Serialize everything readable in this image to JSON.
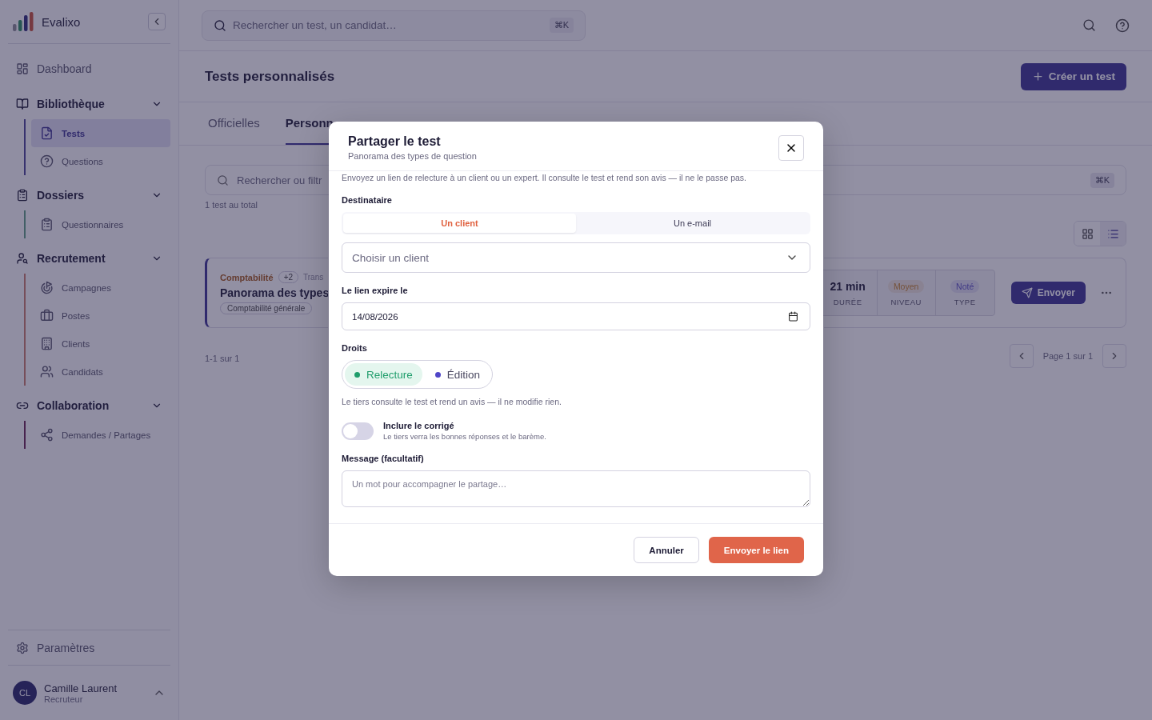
{
  "app": {
    "name": "Evalixo"
  },
  "sidebar": {
    "items": [
      {
        "kind": "link",
        "label": "Dashboard",
        "selected": false
      },
      {
        "kind": "section",
        "label": "Bibliothèque",
        "expanded": true,
        "children": [
          {
            "label": "Tests",
            "selected": true
          },
          {
            "label": "Questions",
            "selected": false
          }
        ]
      },
      {
        "kind": "section",
        "label": "Dossiers",
        "expanded": true,
        "children": [
          {
            "label": "Questionnaires",
            "selected": false
          }
        ]
      },
      {
        "kind": "section",
        "label": "Recrutement",
        "expanded": true,
        "children": [
          {
            "label": "Campagnes",
            "selected": false
          },
          {
            "label": "Postes",
            "selected": false
          },
          {
            "label": "Clients",
            "selected": false
          },
          {
            "label": "Candidats",
            "selected": false
          }
        ]
      },
      {
        "kind": "section",
        "label": "Collaboration",
        "expanded": true,
        "children": [
          {
            "label": "Demandes / Partages",
            "selected": false
          }
        ]
      }
    ],
    "settings": "Paramètres",
    "user": {
      "initials": "CL",
      "name": "Camille Laurent",
      "role": "Recruteur"
    }
  },
  "search": {
    "placeholder": "Rechercher un test, un candidat…",
    "shortcut": "⌘K"
  },
  "header": {
    "title": "Tests personnalisés",
    "create_button": "Créer un test"
  },
  "tabs": [
    {
      "label": "Officielles",
      "selected": false
    },
    {
      "label": "Personn",
      "selected": true
    }
  ],
  "filter": {
    "placeholder": "Rechercher ou filtr",
    "shortcut": "⌘K"
  },
  "total": "1 test au total",
  "view_toggle": [
    {
      "kind": "grid",
      "selected": false
    },
    {
      "kind": "list",
      "selected": true
    }
  ],
  "card": {
    "category": "Comptabilité",
    "extra": "+2",
    "cut_tag": "Trans",
    "title": "Panorama des types",
    "tags": [
      "Comptabilité générale"
    ],
    "stats": [
      {
        "kind": "text",
        "value": "21 min",
        "label": "DURÉE"
      },
      {
        "kind": "badge",
        "value": "Moyen",
        "label": "NIVEAU"
      },
      {
        "kind": "badge",
        "value": "Noté",
        "label": "TYPE"
      }
    ],
    "send": "Envoyer"
  },
  "pagination": {
    "range": "1-1 sur 1",
    "page": "Page 1 sur 1"
  },
  "dialog": {
    "title": "Partager le test",
    "subtitle": "Panorama des types de question",
    "intro": "Envoyez un lien de relecture à un client ou un expert. Il consulte le test et rend son avis — il ne le passe pas.",
    "recipient_label": "Destinataire",
    "recipient_options": [
      {
        "label": "Un client",
        "selected": true
      },
      {
        "label": "Un e-mail",
        "selected": false
      }
    ],
    "client_select": {
      "placeholder": "Choisir un client"
    },
    "expiry_label": "Le lien expire le",
    "expiry_value": "14/08/2026",
    "rights_label": "Droits",
    "rights": [
      {
        "label": "Relecture",
        "selected": true,
        "color": "#1f9d6b"
      },
      {
        "label": "Édition",
        "selected": false,
        "color": "#5046c8"
      }
    ],
    "rights_hint": "Le tiers consulte le test et rend un avis — il ne modifie rien.",
    "answer_key": {
      "label": "Inclure le corrigé",
      "hint": "Le tiers verra les bonnes réponses et le barème.",
      "on": false
    },
    "message_label": "Message (facultatif)",
    "message": {
      "placeholder": "Un mot pour accompagner le partage…"
    },
    "cancel": "Annuler",
    "submit": "Envoyer le lien"
  }
}
